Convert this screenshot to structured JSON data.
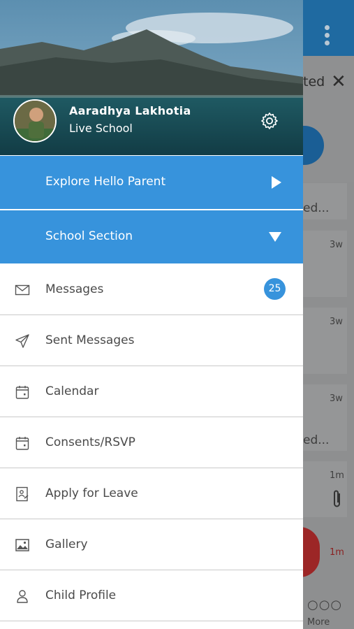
{
  "background_app": {
    "header_title_fragment": "ted",
    "close_symbol": "✕",
    "card_texts": [
      "ed...",
      "ed..."
    ],
    "times": [
      "3w",
      "3w",
      "3w",
      "1m",
      "1m"
    ],
    "tab_more_label": "More"
  },
  "drawer": {
    "user": {
      "name": "Aaradhya Lakhotia",
      "school": "Live School"
    },
    "sections": [
      {
        "label": "Explore Hello Parent",
        "arrow": "right"
      },
      {
        "label": "School Section",
        "arrow": "down"
      }
    ],
    "menu_items": [
      {
        "label": "Messages",
        "icon": "envelope-icon",
        "badge": "25"
      },
      {
        "label": "Sent Messages",
        "icon": "paper-plane-icon"
      },
      {
        "label": "Calendar",
        "icon": "calendar-icon"
      },
      {
        "label": "Consents/RSVP",
        "icon": "calendar-icon"
      },
      {
        "label": "Apply for Leave",
        "icon": "leave-document-icon"
      },
      {
        "label": "Gallery",
        "icon": "image-icon"
      },
      {
        "label": "Child Profile",
        "icon": "person-icon"
      }
    ]
  },
  "colors": {
    "accent_blue": "#3793dc",
    "topbar_blue_dimmed": "#1f6aa1"
  }
}
